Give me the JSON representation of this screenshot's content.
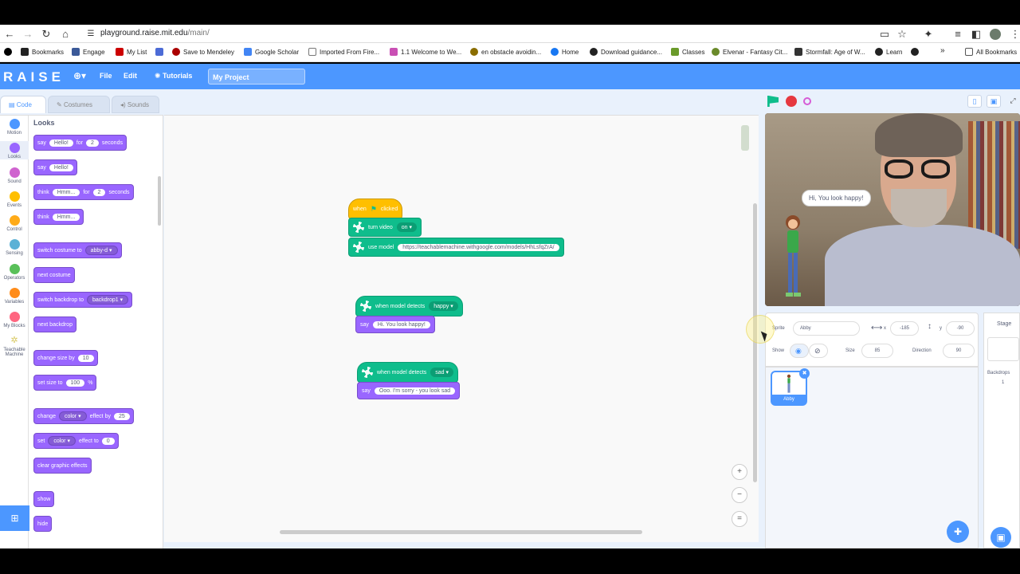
{
  "browser": {
    "url_host": "playground.raise.mit.edu",
    "url_path": "/main/",
    "bookmarks": [
      {
        "label": "Bookmarks",
        "color": "#222"
      },
      {
        "label": "Engage",
        "color": "#3b5998"
      },
      {
        "label": "My List",
        "color": "#c00"
      },
      {
        "label": "",
        "color": "#4c6bd6"
      },
      {
        "label": "Save to Mendeley",
        "color": "#a00"
      },
      {
        "label": "Google Scholar",
        "color": "#4285f4"
      },
      {
        "label": "Imported From Fire...",
        "color": "#777"
      },
      {
        "label": "1.1 Welcome to We...",
        "color": "#c94fb4"
      },
      {
        "label": "en obstacle avoidin...",
        "color": "#8a6d00"
      },
      {
        "label": "Home",
        "color": "#1877f2"
      },
      {
        "label": "Download guidance...",
        "color": "#222"
      },
      {
        "label": "Classes",
        "color": "#6a9a2a"
      },
      {
        "label": "Elvenar - Fantasy Cit...",
        "color": "#6a8a2a"
      },
      {
        "label": "Stormfall: Age of W...",
        "color": "#333"
      },
      {
        "label": "Learn",
        "color": "#222"
      },
      {
        "label": "",
        "color": "#222"
      }
    ],
    "more_label": "»",
    "all_bookmarks": "All Bookmarks"
  },
  "menubar": {
    "logo": "RAISE",
    "file": "File",
    "edit": "Edit",
    "tutorials": "Tutorials",
    "project_title": "My Project"
  },
  "tabs": {
    "code": "Code",
    "costumes": "Costumes",
    "sounds": "Sounds"
  },
  "categories": [
    {
      "label": "Motion",
      "color": "#4c97ff"
    },
    {
      "label": "Looks",
      "color": "#9966ff"
    },
    {
      "label": "Sound",
      "color": "#cf63cf"
    },
    {
      "label": "Events",
      "color": "#ffbf00"
    },
    {
      "label": "Control",
      "color": "#ffab19"
    },
    {
      "label": "Sensing",
      "color": "#5cb1d6"
    },
    {
      "label": "Operators",
      "color": "#59c059"
    },
    {
      "label": "Variables",
      "color": "#ff8c1a"
    },
    {
      "label": "My Blocks",
      "color": "#ff6680"
    },
    {
      "label": "Teachable Machine",
      "color": "#e0d070"
    }
  ],
  "palette": {
    "title": "Looks",
    "say_for": {
      "say": "say",
      "text": "Hello!",
      "for": "for",
      "num": "2",
      "seconds": "seconds"
    },
    "say": {
      "say": "say",
      "text": "Hello!"
    },
    "think_for": {
      "think": "think",
      "text": "Hmm...",
      "for": "for",
      "num": "2",
      "seconds": "seconds"
    },
    "think": {
      "think": "think",
      "text": "Hmm..."
    },
    "switch_costume": {
      "label": "switch costume to",
      "value": "abby-d"
    },
    "next_costume": "next costume",
    "switch_backdrop": {
      "label": "switch backdrop to",
      "value": "backdrop1"
    },
    "next_backdrop": "next backdrop",
    "change_size": {
      "label": "change size by",
      "value": "10"
    },
    "set_size": {
      "label": "set size to",
      "value": "100",
      "unit": "%"
    },
    "change_effect": {
      "label": "change",
      "effect": "color",
      "by": "effect by",
      "value": "25"
    },
    "set_effect": {
      "label": "set",
      "effect": "color",
      "to": "effect to",
      "value": "0"
    },
    "clear_effects": "clear graphic effects",
    "show": "show",
    "hide": "hide"
  },
  "script": {
    "when_clicked": {
      "when": "when",
      "clicked": "clicked"
    },
    "turn_video": {
      "label": "turn video",
      "value": "on"
    },
    "use_model": {
      "label": "use model",
      "url": "https://teachablemachine.withgoogle.com/models/HhLsfqZrA/"
    },
    "detect_happy": {
      "label": "when model detects",
      "value": "happy"
    },
    "say_happy": {
      "say": "say",
      "text": "Hi. You look happy!"
    },
    "detect_sad": {
      "label": "when model detects",
      "value": "sad"
    },
    "say_sad": {
      "say": "say",
      "text": "Ooo. I'm sorry - you look sad"
    }
  },
  "zoom": {
    "in": "+",
    "out": "−",
    "reset": "="
  },
  "stage": {
    "speech": "Hi, You look happy!"
  },
  "sprite_info": {
    "sprite_label": "Sprite",
    "sprite_name": "Abby",
    "x_label": "x",
    "x_value": "-185",
    "y_label": "y",
    "y_value": "-90",
    "show_label": "Show",
    "size_label": "Size",
    "size_value": "85",
    "direction_label": "Direction",
    "direction_value": "90"
  },
  "sprites": [
    {
      "name": "Abby"
    }
  ],
  "stage_panel": {
    "title": "Stage",
    "backdrops_label": "Backdrops",
    "backdrops_count": "1"
  }
}
